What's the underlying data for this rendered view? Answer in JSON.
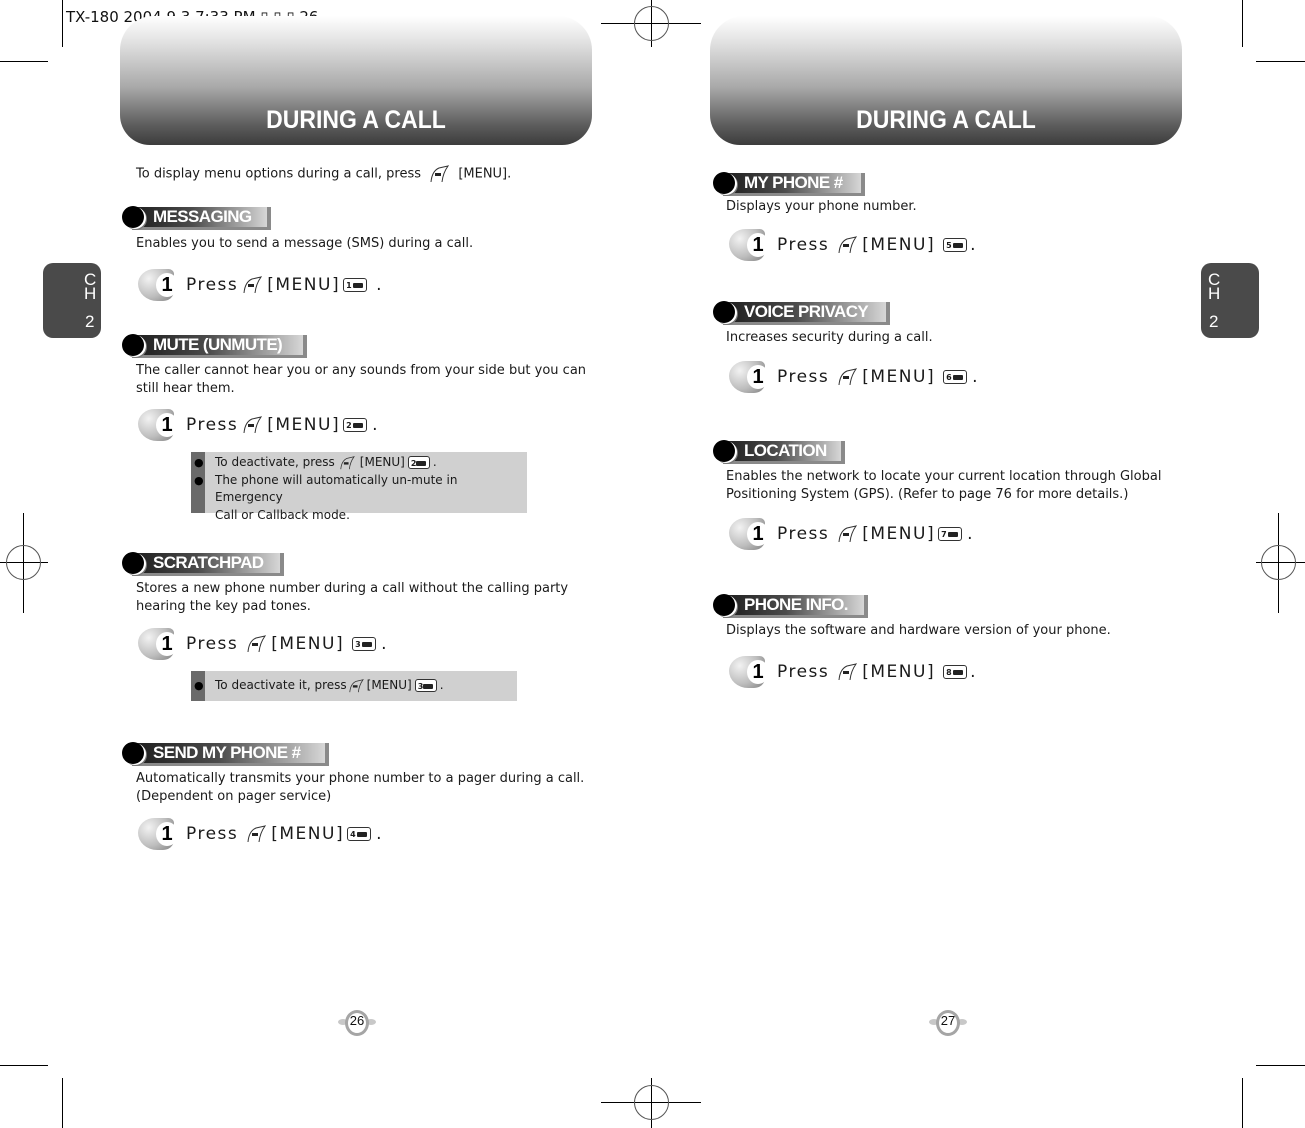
{
  "print_header": "TX-180  2004.9.3 7:33 PM ▯ ▯ ▯ 26",
  "left_page": {
    "banner_title": "DURING A CALL",
    "chapter_tab": {
      "letters": [
        "C",
        "H"
      ],
      "number": "2"
    },
    "intro": {
      "before": "To display menu options during a call, press",
      "after": "[MENU]."
    },
    "sections": [
      {
        "title": "MESSAGING",
        "description": [
          "Enables you to send a message (SMS) during a call."
        ],
        "step": {
          "number": "1",
          "press": "Press",
          "menu": "[MENU]",
          "key": "1",
          "end": "."
        }
      },
      {
        "title": "MUTE (UNMUTE)",
        "description": [
          "The caller cannot hear you or any sounds from your side but you can",
          "still hear them."
        ],
        "step": {
          "number": "1",
          "press": "Press",
          "menu": "[MENU]",
          "key": "2",
          "end": "."
        },
        "notes": {
          "line1_before": "To deactivate, press",
          "line1_menu": "[MENU]",
          "line1_key": "2",
          "line1_end": ".",
          "line2": "The phone will automatically un-mute in Emergency",
          "line3": "Call or Callback mode."
        }
      },
      {
        "title": "SCRATCHPAD",
        "description": [
          "Stores a new phone number during a call without the calling party",
          "hearing the key pad tones."
        ],
        "step": {
          "number": "1",
          "press": "Press",
          "menu": "[MENU]",
          "key": "3",
          "end": "."
        },
        "notes": {
          "line1_before": "To deactivate it, press",
          "line1_menu": "[MENU]",
          "line1_key": "3",
          "line1_end": "."
        }
      },
      {
        "title": "SEND MY PHONE #",
        "description": [
          "Automatically transmits your phone number to a pager during a call.",
          "(Dependent on pager service)"
        ],
        "step": {
          "number": "1",
          "press": "Press",
          "menu": "[MENU]",
          "key": "4",
          "end": "."
        }
      }
    ],
    "page_number": "26"
  },
  "right_page": {
    "banner_title": "DURING A CALL",
    "chapter_tab": {
      "letters": [
        "C",
        "H"
      ],
      "number": "2"
    },
    "sections": [
      {
        "title": "MY PHONE #",
        "description": [
          "Displays your phone number."
        ],
        "step": {
          "number": "1",
          "press": "Press",
          "menu": "[MENU]",
          "key": "5",
          "end": "."
        }
      },
      {
        "title": "VOICE PRIVACY",
        "description": [
          "Increases security during a call."
        ],
        "step": {
          "number": "1",
          "press": "Press",
          "menu": "[MENU]",
          "key": "6",
          "end": "."
        }
      },
      {
        "title": "LOCATION",
        "description": [
          "Enables the network to locate your current location through Global",
          "Positioning System (GPS). (Refer to page 76 for more details.)"
        ],
        "step": {
          "number": "1",
          "press": "Press",
          "menu": "[MENU]",
          "key": "7",
          "end": "."
        }
      },
      {
        "title": "PHONE INFO.",
        "description": [
          "Displays the software and hardware version of your phone."
        ],
        "step": {
          "number": "1",
          "press": "Press",
          "menu": "[MENU]",
          "key": "8",
          "end": "."
        }
      }
    ],
    "page_number": "27"
  }
}
